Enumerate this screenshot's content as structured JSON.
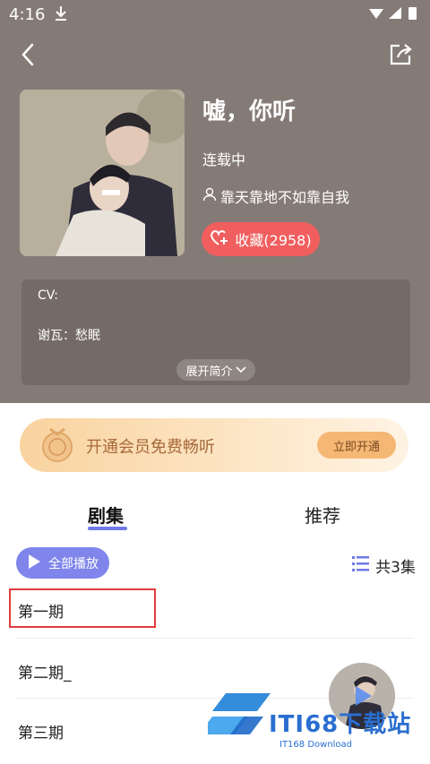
{
  "statusbar": {
    "time": "4:16",
    "download_icon": "download-icon",
    "signal": "▾◢▮"
  },
  "album": {
    "title": "嘘，你听",
    "status": "连载中",
    "author": "靠天靠地不如靠自我",
    "favorite_label": "收藏(2958)"
  },
  "intro": {
    "line1": "CV:",
    "line2": "谢瓦：愁眠",
    "expand_label": "展开简介"
  },
  "vip": {
    "text": "开通会员免费畅听",
    "button": "立即开通"
  },
  "tabs": [
    {
      "label": "剧集",
      "active": true
    },
    {
      "label": "推荐",
      "active": false
    }
  ],
  "playall_label": "全部播放",
  "episode_count": "共3集",
  "episodes": [
    {
      "title": "第一期"
    },
    {
      "title": "第二期_"
    },
    {
      "title": "第三期"
    }
  ],
  "watermark": {
    "title": "ITI68下载站",
    "subtitle": "IT168 Download"
  },
  "colors": {
    "header_bg": "#857b76",
    "fav_red": "#f05e5e",
    "accent": "#6f7ae8",
    "vip_gold": "#f5b774"
  }
}
